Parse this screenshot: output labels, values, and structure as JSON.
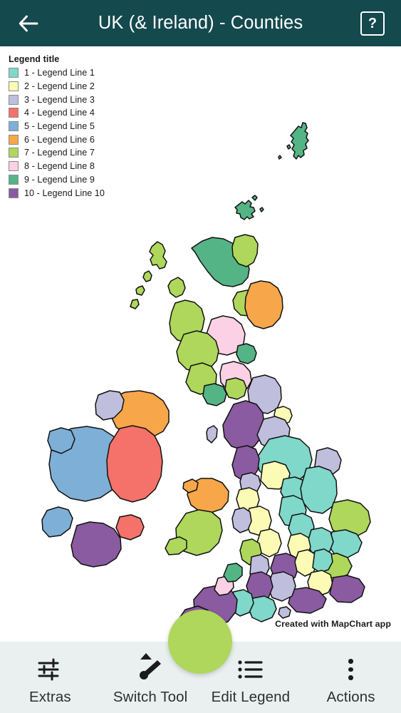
{
  "header": {
    "title": "UK (& Ireland) - Counties",
    "back_icon": "back-arrow-icon",
    "help_label": "?",
    "bg_color": "#14494e"
  },
  "legend": {
    "title": "Legend title",
    "items": [
      {
        "label": "1 - Legend Line 1",
        "color": "#7fd8c9"
      },
      {
        "label": "2 - Legend Line 2",
        "color": "#fbfbb6"
      },
      {
        "label": "3 - Legend Line 3",
        "color": "#c0bedd"
      },
      {
        "label": "4 - Legend Line 4",
        "color": "#f4726a"
      },
      {
        "label": "5 - Legend Line 5",
        "color": "#7eafd6"
      },
      {
        "label": "6 - Legend Line 6",
        "color": "#f7a64a"
      },
      {
        "label": "7 - Legend Line 7",
        "color": "#aed75c"
      },
      {
        "label": "8 - Legend Line 8",
        "color": "#fcd1e6"
      },
      {
        "label": "9 - Legend Line 9",
        "color": "#55b485"
      },
      {
        "label": "10 - Legend Line 10",
        "color": "#8a5ba0"
      }
    ]
  },
  "watermark": {
    "text": "Created with MapChart app"
  },
  "fab": {
    "name": "selected-color-button",
    "color": "#aed75c"
  },
  "toolbar": {
    "items": [
      {
        "label": "Extras",
        "icon": "sliders-icon"
      },
      {
        "label": "Switch Tool",
        "icon": "brush-icon"
      },
      {
        "label": "Edit Legend",
        "icon": "list-icon"
      },
      {
        "label": "Actions",
        "icon": "more-vertical-icon"
      }
    ]
  },
  "map": {
    "title": "UK & Ireland counties choropleth",
    "stroke_color": "#111111",
    "background": "#ffffff"
  }
}
